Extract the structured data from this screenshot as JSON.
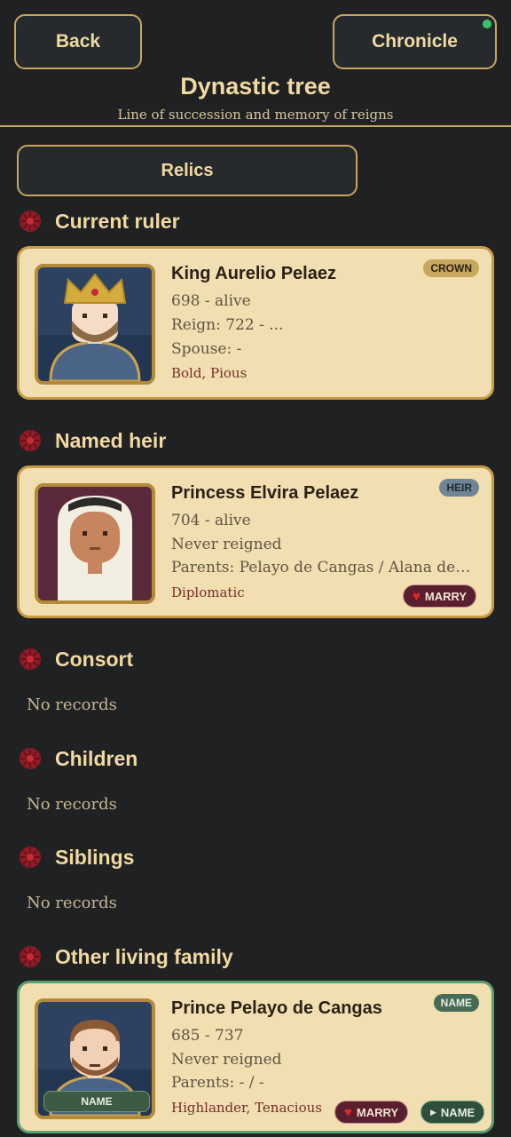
{
  "header": {
    "back_label": "Back",
    "chronicle_label": "Chronicle",
    "title": "Dynastic tree",
    "subtitle": "Line of succession and memory of reigns"
  },
  "relics_label": "Relics",
  "colors": {
    "background": "#1f2123",
    "gold": "#c8a660",
    "card": "#f1dfb1",
    "accent_red": "#7a2b2b",
    "notification": "#39c46a"
  },
  "sections": {
    "current_ruler": {
      "title": "Current ruler",
      "person": {
        "name": "King Aurelio Pelaez",
        "badge": "CROWN",
        "line1": "698 - alive",
        "line2": "Reign: 722 - ...",
        "line3": "Spouse: -",
        "traits": "Bold, Pious",
        "portrait_icon": "crowned-king-portrait"
      }
    },
    "named_heir": {
      "title": "Named heir",
      "person": {
        "name": "Princess Elvira Pelaez",
        "badge": "HEIR",
        "line1": "704 - alive",
        "line2": "Never reigned",
        "line3": "Parents: Pelayo de Cangas / Alana de lo...",
        "traits": "Diplomatic",
        "marry_label": "MARRY",
        "portrait_icon": "veiled-princess-portrait"
      }
    },
    "consort": {
      "title": "Consort",
      "empty": "No records"
    },
    "children": {
      "title": "Children",
      "empty": "No records"
    },
    "siblings": {
      "title": "Siblings",
      "empty": "No records"
    },
    "other_family": {
      "title": "Other living family",
      "person": {
        "name": "Prince Pelayo de Cangas",
        "badge": "NAME",
        "line1": "685 - 737",
        "line2": "Never reigned",
        "line3": "Parents: - / -",
        "traits": "Highlander, Tenacious",
        "marry_label": "MARRY",
        "name_button_label": "NAME",
        "portrait_tag": "NAME",
        "portrait_icon": "bearded-prince-portrait"
      }
    }
  }
}
